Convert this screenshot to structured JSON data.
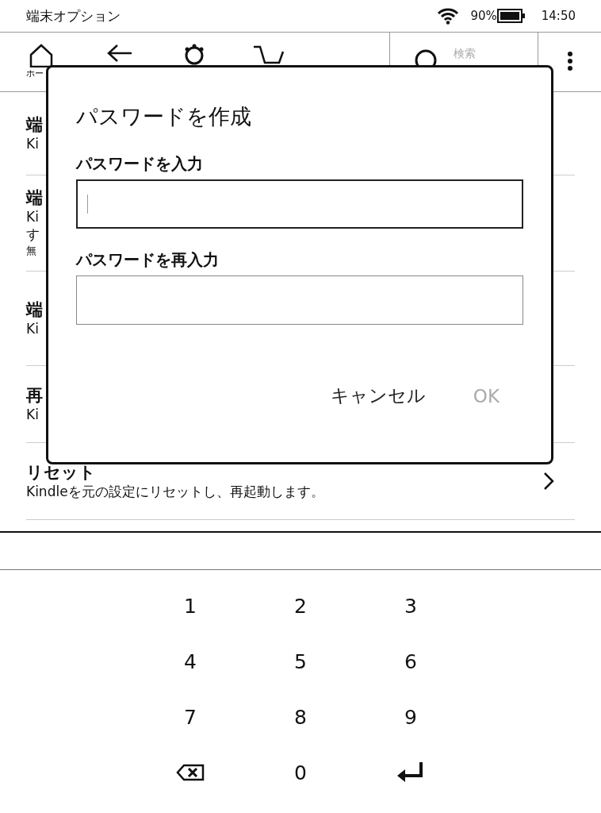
{
  "status_bar": {
    "title": "端末オプション",
    "battery": "90%",
    "time": "14:50"
  },
  "toolbar": {
    "home_label": "ホー",
    "search_placeholder": "検索"
  },
  "list_items": [
    {
      "title": "端",
      "lines": [
        {
          "text": "Ki",
          "kind": "body"
        }
      ]
    },
    {
      "title": "端",
      "lines": [
        {
          "text": "Ki",
          "kind": "body"
        },
        {
          "text": "す",
          "kind": "body"
        },
        {
          "text": "無",
          "kind": "note"
        }
      ]
    },
    {
      "title": "端",
      "lines": [
        {
          "text": "Ki",
          "kind": "body"
        }
      ]
    },
    {
      "title": "再",
      "lines": [
        {
          "text": "Ki",
          "kind": "body"
        }
      ]
    },
    {
      "title": "リセット",
      "lines": [
        {
          "text": "Kindleを元の設定にリセットし、再起動します。",
          "kind": "body"
        }
      ],
      "chevron": true
    }
  ],
  "dialog": {
    "title": "パスワードを作成",
    "fields": [
      {
        "label": "パスワードを入力",
        "focused": true
      },
      {
        "label": "パスワードを再入力",
        "focused": false
      }
    ],
    "buttons": [
      {
        "label": "キャンセル",
        "disabled": false
      },
      {
        "label": "OK",
        "disabled": true
      }
    ]
  },
  "keypad": [
    {
      "kind": "digit",
      "label": "1"
    },
    {
      "kind": "digit",
      "label": "2"
    },
    {
      "kind": "digit",
      "label": "3"
    },
    {
      "kind": "digit",
      "label": "4"
    },
    {
      "kind": "digit",
      "label": "5"
    },
    {
      "kind": "digit",
      "label": "6"
    },
    {
      "kind": "digit",
      "label": "7"
    },
    {
      "kind": "digit",
      "label": "8"
    },
    {
      "kind": "digit",
      "label": "9"
    },
    {
      "kind": "backspace"
    },
    {
      "kind": "digit",
      "label": "0"
    },
    {
      "kind": "enter"
    }
  ]
}
